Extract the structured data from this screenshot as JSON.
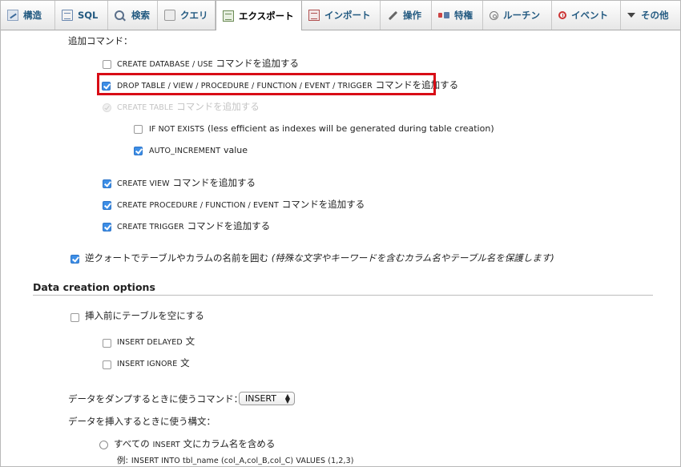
{
  "tabs": [
    {
      "label": "構造",
      "icon": "structure-icon"
    },
    {
      "label": "SQL",
      "icon": "sql-icon"
    },
    {
      "label": "検索",
      "icon": "search-icon"
    },
    {
      "label": "クエリ",
      "icon": "query-icon"
    },
    {
      "label": "エクスポート",
      "icon": "export-icon",
      "active": true
    },
    {
      "label": "インポート",
      "icon": "import-icon"
    },
    {
      "label": "操作",
      "icon": "wrench-icon"
    },
    {
      "label": "特権",
      "icon": "privileges-icon"
    },
    {
      "label": "ルーチン",
      "icon": "routines-icon"
    },
    {
      "label": "イベント",
      "icon": "events-icon"
    },
    {
      "label": "その他",
      "icon": "chevron-down-icon"
    }
  ],
  "add_commands": {
    "heading": "追加コマンド：",
    "create_database": {
      "sql": "CREATE DATABASE / USE",
      "jp": "コマンドを追加する",
      "checked": false
    },
    "drop_table": {
      "sql": "DROP TABLE / VIEW / PROCEDURE / FUNCTION / EVENT / TRIGGER",
      "jp": "コマンドを追加する",
      "checked": true
    },
    "create_table": {
      "sql": "CREATE TABLE",
      "jp": "コマンドを追加する",
      "checked": true,
      "disabled": true
    },
    "if_not_exists": {
      "sql": "IF NOT EXISTS",
      "rest": "(less efficient as indexes will be generated during table creation)",
      "checked": false
    },
    "auto_increment": {
      "sql": "AUTO_INCREMENT",
      "rest": "value",
      "checked": true
    },
    "create_view": {
      "sql": "CREATE VIEW",
      "jp": "コマンドを追加する",
      "checked": true
    },
    "create_procedure": {
      "sql": "CREATE PROCEDURE / FUNCTION / EVENT",
      "jp": "コマンドを追加する",
      "checked": true
    },
    "create_trigger": {
      "sql": "CREATE TRIGGER",
      "jp": "コマンドを追加する",
      "checked": true
    }
  },
  "backquotes": {
    "label": "逆クォートでテーブルやカラムの名前を囲む",
    "note": "(特殊な文字やキーワードを含むカラム名やテーブル名を保護します)",
    "checked": true
  },
  "data_creation": {
    "title": "Data creation options",
    "truncate": {
      "label": "挿入前にテーブルを空にする",
      "checked": false
    },
    "insert_delayed": {
      "sql": "INSERT DELAYED",
      "jp": "文",
      "checked": false
    },
    "insert_ignore": {
      "sql": "INSERT IGNORE",
      "jp": "文",
      "checked": false
    },
    "dump_command_label": "データをダンプするときに使うコマンド：",
    "dump_command_value": "INSERT",
    "insert_syntax_label": "データを挿入するときに使う構文：",
    "complete_insert": {
      "pre": "すべての",
      "sql": "INSERT",
      "post": "文にカラム名を含める",
      "selected": false
    },
    "example": {
      "prefix": "例:",
      "sql": "INSERT INTO tbl_name (col_A,col_B,col_C) VALUES (1,2,3)"
    }
  }
}
